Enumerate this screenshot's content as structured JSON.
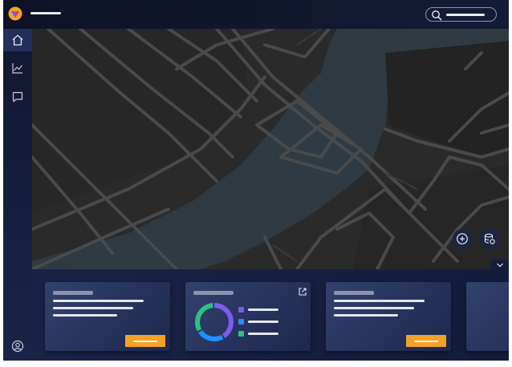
{
  "colors": {
    "accent_orange": "#f4a12a",
    "donut_purple": "#7b5cf0",
    "donut_blue": "#1e90ff",
    "donut_green": "#2ec27e",
    "water": "#2f3a42",
    "road": "#4a4a4a"
  },
  "header": {
    "logo_icon": "app-logo-icon",
    "search_icon": "search-icon"
  },
  "sidebar": {
    "items": [
      {
        "name": "home",
        "icon": "home-icon"
      },
      {
        "name": "analytics",
        "icon": "chart-line-icon"
      },
      {
        "name": "messages",
        "icon": "chat-icon"
      }
    ],
    "footer_icon": "user-circle-icon"
  },
  "map": {
    "controls": [
      {
        "name": "add-place",
        "icon": "plus-circle-icon"
      },
      {
        "name": "data-layers",
        "icon": "database-sync-icon"
      }
    ],
    "collapse_icon": "chevron-down-icon"
  },
  "cards": [
    {
      "type": "text",
      "cta": true
    },
    {
      "type": "donut",
      "open_icon": "external-link-icon",
      "donut_segments": [
        0.42,
        0.25,
        0.33
      ]
    },
    {
      "type": "text",
      "cta": true
    },
    {
      "type": "partial"
    }
  ]
}
